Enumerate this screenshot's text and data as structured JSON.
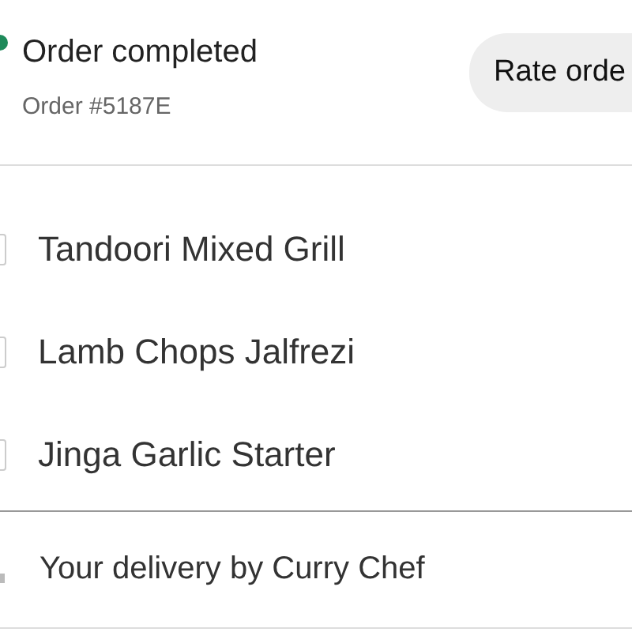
{
  "order": {
    "status": "Order completed",
    "completed": true,
    "number": "Order #5187E",
    "action": "Rate orde"
  },
  "items": [
    {
      "name": "Tandoori Mixed Grill"
    },
    {
      "name": "Lamb Chops Jalfrezi"
    },
    {
      "name": "Jinga Garlic Starter"
    }
  ],
  "delivery": {
    "text": "Your delivery by Curry Chef"
  }
}
